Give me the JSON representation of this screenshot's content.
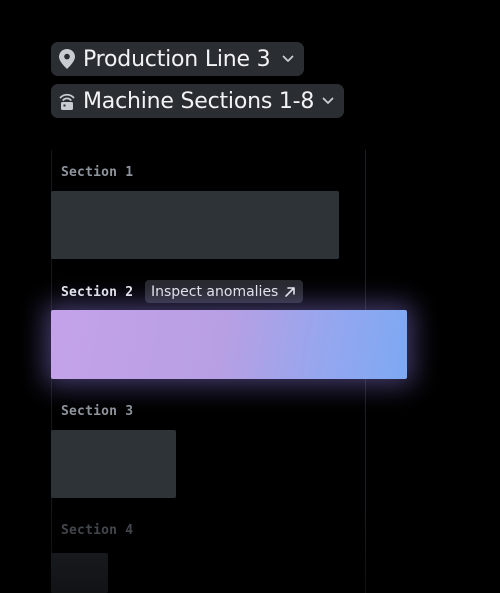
{
  "filters": {
    "location": {
      "label": "Production Line 3",
      "icon": "location-pin-icon"
    },
    "sections": {
      "label": "Machine Sections 1-8",
      "icon": "sensor-icon"
    }
  },
  "sections": [
    {
      "label": "Section 1",
      "level": 0.81,
      "color": "#2e3338"
    },
    {
      "label": "Section 2",
      "level": 1.0,
      "color": "#b89fe3",
      "highlighted": true,
      "action_label": "Inspect anomalies",
      "action_icon": "arrow-up-right-icon"
    },
    {
      "label": "Section 3",
      "level": 0.35,
      "color": "#2e3338"
    },
    {
      "label": "Section 4",
      "level": 0.16,
      "color": "#1e2226"
    }
  ]
}
